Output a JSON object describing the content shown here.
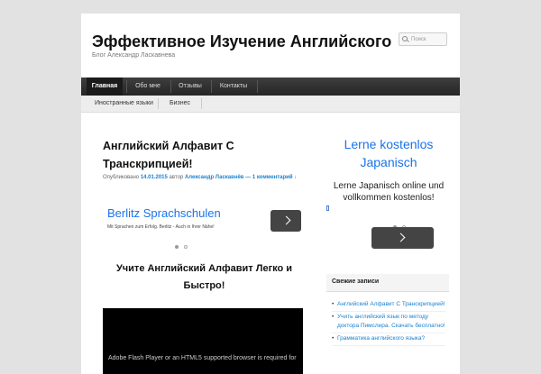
{
  "site": {
    "title": "Эффективное Изучение Английского",
    "description": "Блог Александр Ласкавнева"
  },
  "search": {
    "placeholder": "Поиск"
  },
  "nav": {
    "items": [
      {
        "label": "Главная"
      },
      {
        "label": "Обо мне"
      },
      {
        "label": "Отзывы"
      },
      {
        "label": "Контакты"
      }
    ]
  },
  "subnav": {
    "items": [
      {
        "label": "Иностранные языки"
      },
      {
        "label": "Бизнес"
      }
    ]
  },
  "article": {
    "title": "Английский Алфавит С Транскрипцией!",
    "meta_prefix": "Опубликовано",
    "date": "14.01.2015",
    "meta_author_prefix": "автор",
    "author": "Александр Ласкавнёв",
    "comments": "— 1 комментарий ↓",
    "headline": "Учите Английский Алфавит Легко и Быстро!",
    "video_message": "Adobe Flash Player or an HTML5 supported browser is required for"
  },
  "inline_ad": {
    "title": "Berlitz Sprachschulen",
    "description": "Mit Sprachen zum Erfolg. Berlitz - Auch in Ihrer Nähe!"
  },
  "side_ad": {
    "title": "Lerne kostenlos Japanisch",
    "description": "Lerne Japanisch online und vollkommen kostenlos!"
  },
  "recent_posts": {
    "title": "Свежие записи",
    "items": [
      {
        "label": "Английский Алфавит С Транскрипцией!"
      },
      {
        "label": "Учить английский язык по методу доктора Пимслера. Скачать бесплатно!"
      },
      {
        "label": "Грамматика английского языка?"
      }
    ]
  },
  "colors": {
    "accent": "#1982d1",
    "ad_link": "#1a73e8",
    "nav_bg": "#2f2f2f",
    "page_bg": "#e2e2e2"
  }
}
